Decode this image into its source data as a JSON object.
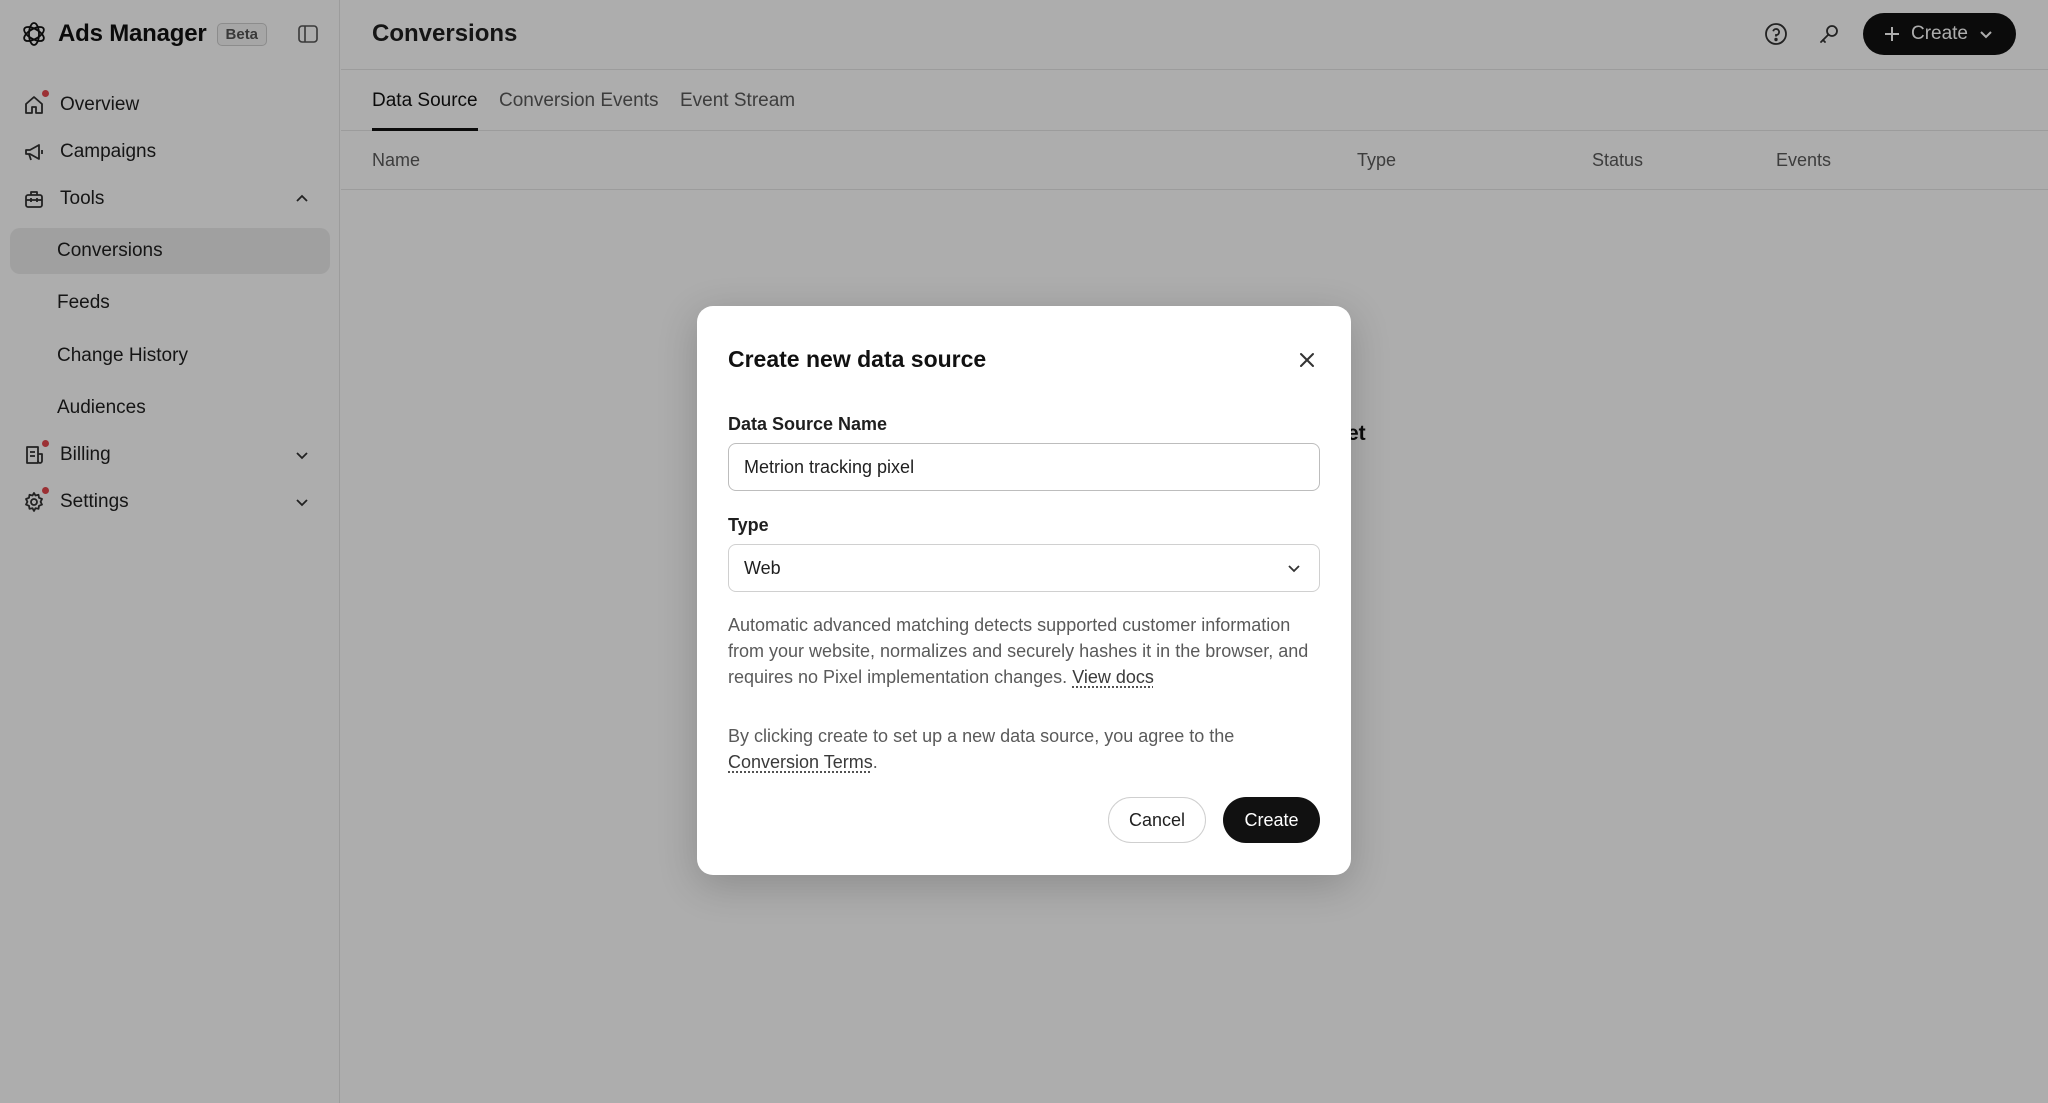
{
  "sidebar": {
    "brand": {
      "title": "Ads Manager",
      "badge": "Beta",
      "logo_icon": "openai-logo-icon"
    },
    "items": [
      {
        "label": "Overview",
        "icon": "home-icon",
        "notification": true
      },
      {
        "label": "Campaigns",
        "icon": "megaphone-icon",
        "notification": false
      },
      {
        "label": "Tools",
        "icon": "toolbox-icon",
        "expanded": true,
        "children": [
          {
            "label": "Conversions",
            "active": true
          },
          {
            "label": "Feeds"
          },
          {
            "label": "Change History"
          },
          {
            "label": "Audiences"
          }
        ]
      },
      {
        "label": "Billing",
        "icon": "receipt-icon",
        "notification": true,
        "expanded": false
      },
      {
        "label": "Settings",
        "icon": "gear-icon",
        "notification": true,
        "expanded": false
      }
    ]
  },
  "header": {
    "title": "Conversions",
    "create_label": "Create",
    "icons": [
      "help-icon",
      "key-icon"
    ]
  },
  "tabs": [
    {
      "label": "Data Source",
      "active": true
    },
    {
      "label": "Conversion Events",
      "active": false
    },
    {
      "label": "Event Stream",
      "active": false
    }
  ],
  "table": {
    "columns": [
      "Name",
      "Type",
      "Status",
      "Events"
    ],
    "empty_text_fragment": "et"
  },
  "modal": {
    "title": "Create new data source",
    "name_label": "Data Source Name",
    "name_value": "Metrion tracking pixel",
    "type_label": "Type",
    "type_value": "Web",
    "description": "Automatic advanced matching detects supported customer information from your website, normalizes and securely hashes it in the browser, and requires no Pixel implementation changes.",
    "view_docs": "View docs",
    "terms_prefix": "By clicking create to set up a new data source, you agree to the",
    "terms_link": "Conversion Terms",
    "terms_suffix": ".",
    "cancel_label": "Cancel",
    "create_label": "Create"
  },
  "colors": {
    "accent": "#111111",
    "notification": "#e5484d",
    "overlay": "rgba(0,0,0,0.32)"
  }
}
